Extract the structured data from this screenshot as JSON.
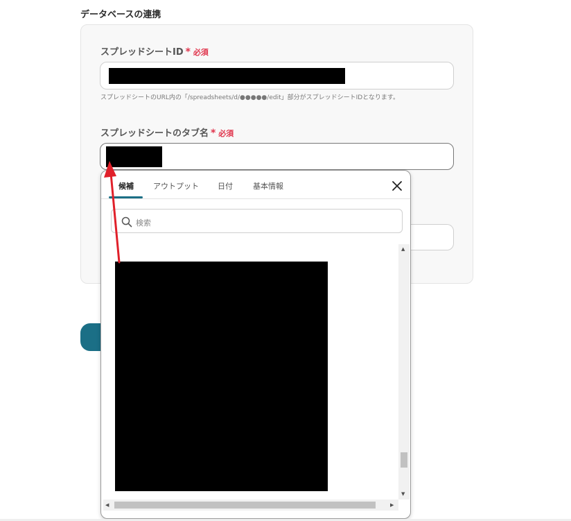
{
  "section": {
    "title": "データベースの連携"
  },
  "fields": {
    "sheet_id": {
      "label": "スプレッドシートID",
      "required": "必須",
      "hint": "スプレッドシートのURL内の「/spreadsheets/d/●●●●●/edit」部分がスプレッドシートIDとなります。"
    },
    "tab_name": {
      "label": "スプレッドシートのタブ名",
      "required": "必須"
    }
  },
  "popup": {
    "tabs": [
      "候補",
      "アウトプット",
      "日付",
      "基本情報"
    ],
    "active_tab": "候補",
    "search": {
      "placeholder": "検索",
      "value": ""
    }
  },
  "icons": {
    "close": "close-icon",
    "search": "search-icon",
    "required_star": "asterisk-icon"
  },
  "colors": {
    "accent": "#1b6f86",
    "required": "#e0344c",
    "annotation_arrow": "#e0202a"
  }
}
